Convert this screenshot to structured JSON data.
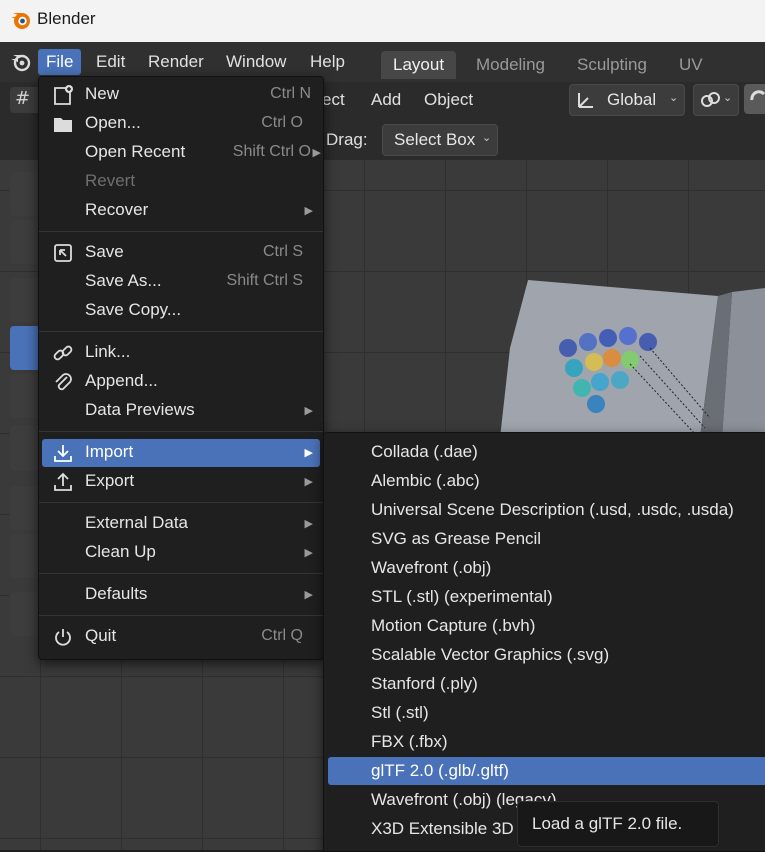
{
  "window": {
    "title": "Blender"
  },
  "menubar": {
    "items": [
      "File",
      "Edit",
      "Render",
      "Window",
      "Help"
    ],
    "workspaces": [
      "Layout",
      "Modeling",
      "Sculpting",
      "UV Editing"
    ]
  },
  "viewport_header": {
    "select_partial": "ect",
    "add": "Add",
    "object": "Object",
    "orientation": "Global",
    "drag_label": "Drag:",
    "drag_value": "Select Box"
  },
  "file_menu": {
    "new": {
      "label": "New",
      "shortcut": "Ctrl N"
    },
    "open": {
      "label": "Open...",
      "shortcut": "Ctrl O"
    },
    "open_recent": {
      "label": "Open Recent",
      "shortcut": "Shift Ctrl O"
    },
    "revert": {
      "label": "Revert"
    },
    "recover": {
      "label": "Recover"
    },
    "save": {
      "label": "Save",
      "shortcut": "Ctrl S"
    },
    "save_as": {
      "label": "Save As...",
      "shortcut": "Shift Ctrl S"
    },
    "save_copy": {
      "label": "Save Copy..."
    },
    "link": {
      "label": "Link..."
    },
    "append": {
      "label": "Append..."
    },
    "data_previews": {
      "label": "Data Previews"
    },
    "import": {
      "label": "Import"
    },
    "export": {
      "label": "Export"
    },
    "external_data": {
      "label": "External Data"
    },
    "clean_up": {
      "label": "Clean Up"
    },
    "defaults": {
      "label": "Defaults"
    },
    "quit": {
      "label": "Quit",
      "shortcut": "Ctrl Q"
    }
  },
  "import_menu": {
    "items": [
      "Collada (.dae)",
      "Alembic (.abc)",
      "Universal Scene Description (.usd, .usdc, .usda)",
      "SVG as Grease Pencil",
      "Wavefront (.obj)",
      "STL (.stl) (experimental)",
      "Motion Capture (.bvh)",
      "Scalable Vector Graphics (.svg)",
      "Stanford (.ply)",
      "Stl (.stl)",
      "FBX (.fbx)",
      "glTF 2.0 (.glb/.gltf)",
      "Wavefront (.obj) (legacy)",
      "X3D Extensible 3D ("
    ],
    "highlighted": "glTF 2.0 (.glb/.gltf)"
  },
  "tooltip": {
    "text": "Load a glTF 2.0 file."
  },
  "colors": {
    "accent": "#4a72b8",
    "menu_bg": "#1f1f1f",
    "titlebar": "#f3f3f3"
  }
}
